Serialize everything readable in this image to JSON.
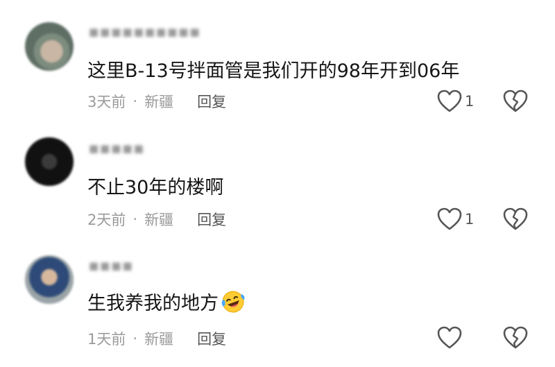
{
  "comments": [
    {
      "text": "这里B-13号拌面管是我们开的98年开到06年",
      "time": "3天前",
      "separator": "·",
      "location": "新疆",
      "reply_label": "回复",
      "likes": "1"
    },
    {
      "text": "不止30年的楼啊",
      "time": "2天前",
      "separator": "·",
      "location": "新疆",
      "reply_label": "回复",
      "likes": "1"
    },
    {
      "text": "生我养我的地方",
      "emoji": "laughing-crying-emoji",
      "time": "1天前",
      "separator": "·",
      "location": "新疆",
      "reply_label": "回复",
      "likes": ""
    }
  ],
  "icons": {
    "like": "heart-icon",
    "dislike": "broken-heart-icon"
  },
  "colors": {
    "text": "#161616",
    "meta": "#9a9a9a",
    "action": "#555555"
  }
}
